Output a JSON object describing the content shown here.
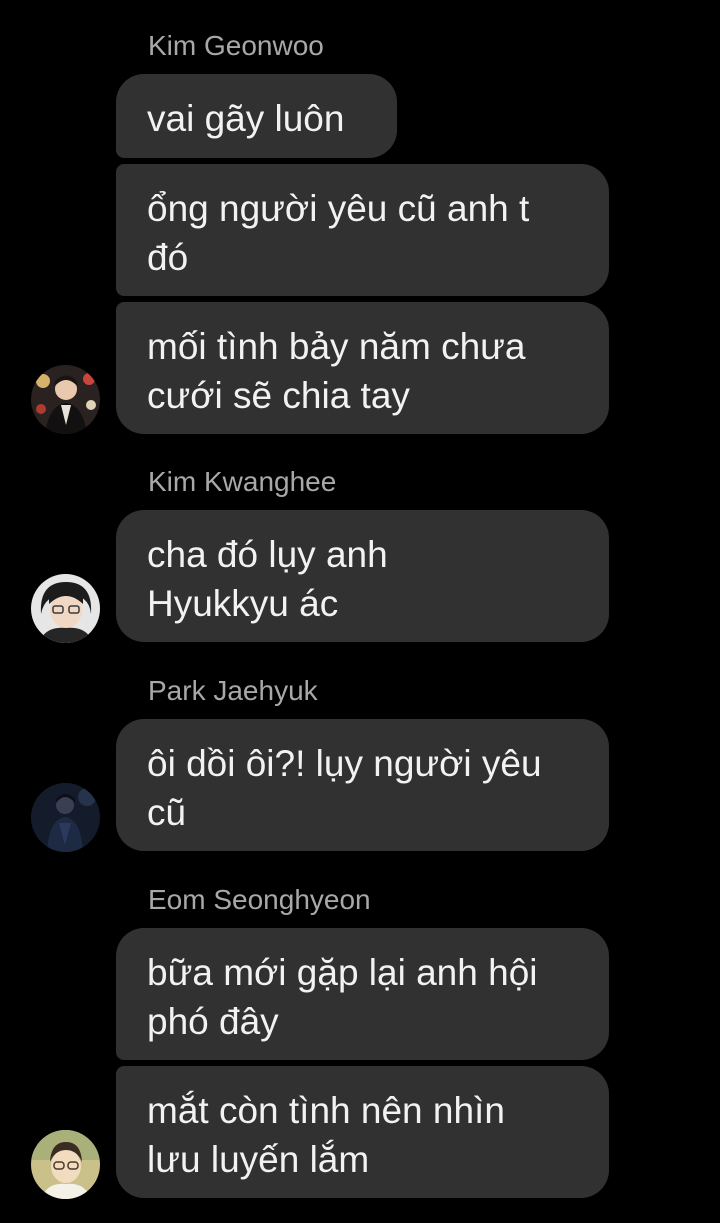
{
  "groups": [
    {
      "sender": "Kim Geonwoo",
      "avatar_icon": "profile-photo-icon",
      "messages": [
        "vai gãy luôn",
        "ổng người yêu cũ anh t\nđó",
        "mối tình bảy năm chưa\ncưới sẽ chia tay"
      ]
    },
    {
      "sender": "Kim Kwanghee",
      "avatar_icon": "profile-photo-icon",
      "messages": [
        "cha đó lụy anh\nHyukkyu ác"
      ]
    },
    {
      "sender": "Park Jaehyuk",
      "avatar_icon": "profile-photo-icon",
      "messages": [
        "ôi dồi ôi?! lụy người yêu\ncũ"
      ]
    },
    {
      "sender": "Eom Seonghyeon",
      "avatar_icon": "profile-photo-icon",
      "messages": [
        "bữa mới gặp lại anh hội\nphó đây",
        "mắt còn tình nên nhìn\nlưu luyến lắm"
      ]
    }
  ],
  "colors": {
    "background": "#000000",
    "bubble": "#313131",
    "message_text": "#f2f2f2",
    "sender_text": "#a8a8a8"
  }
}
